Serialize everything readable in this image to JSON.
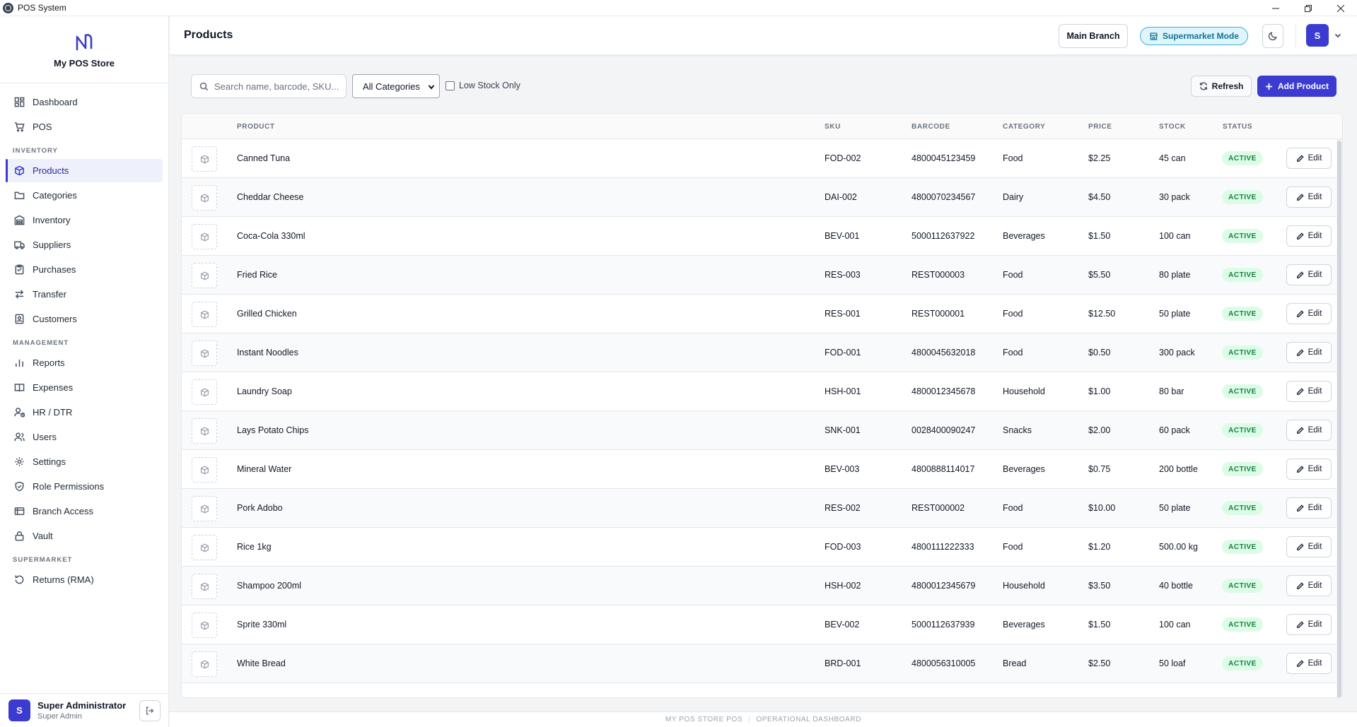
{
  "window": {
    "title": "POS System",
    "controls": [
      "minimize-icon",
      "restore-icon",
      "close-icon"
    ]
  },
  "sidebar": {
    "store_name": "My POS Store",
    "top_items": [
      {
        "label": "Dashboard",
        "icon": "dashboard-icon"
      },
      {
        "label": "POS",
        "icon": "cart-icon"
      }
    ],
    "sections": [
      {
        "label": "INVENTORY",
        "items": [
          {
            "label": "Products",
            "icon": "box-icon",
            "active": true
          },
          {
            "label": "Categories",
            "icon": "folder-icon"
          },
          {
            "label": "Inventory",
            "icon": "warehouse-icon"
          },
          {
            "label": "Suppliers",
            "icon": "truck-icon"
          },
          {
            "label": "Purchases",
            "icon": "clipboard-icon"
          },
          {
            "label": "Transfer",
            "icon": "transfer-icon"
          },
          {
            "label": "Customers",
            "icon": "contacts-icon"
          }
        ]
      },
      {
        "label": "MANAGEMENT",
        "items": [
          {
            "label": "Reports",
            "icon": "bar-chart-icon"
          },
          {
            "label": "Expenses",
            "icon": "book-icon"
          },
          {
            "label": "HR / DTR",
            "icon": "user-clock-icon"
          },
          {
            "label": "Users",
            "icon": "users-icon"
          },
          {
            "label": "Settings",
            "icon": "gear-icon"
          },
          {
            "label": "Role Permissions",
            "icon": "shield-icon"
          },
          {
            "label": "Branch Access",
            "icon": "building-icon"
          },
          {
            "label": "Vault",
            "icon": "lock-icon"
          }
        ]
      },
      {
        "label": "SUPERMARKET",
        "items": [
          {
            "label": "Returns (RMA)",
            "icon": "rotate-icon"
          }
        ]
      }
    ],
    "user": {
      "initial": "S",
      "name": "Super Administrator",
      "role": "Super Admin"
    }
  },
  "header": {
    "title": "Products",
    "branch": "Main Branch",
    "mode": "Supermarket Mode",
    "user_initial": "S"
  },
  "toolbar": {
    "search_placeholder": "Search name, barcode, SKU...",
    "category_selected": "All Categories",
    "low_stock_label": "Low Stock Only",
    "low_stock_checked": false,
    "refresh_label": "Refresh",
    "add_label": "Add Product"
  },
  "table": {
    "columns": {
      "product": "PRODUCT",
      "sku": "SKU",
      "barcode": "BARCODE",
      "category": "CATEGORY",
      "price": "PRICE",
      "stock": "STOCK",
      "status": "STATUS"
    },
    "edit_label": "Edit",
    "rows": [
      {
        "name": "Canned Tuna",
        "sku": "FOD-002",
        "barcode": "4800045123459",
        "category": "Food",
        "price": "$2.25",
        "stock": "45 can",
        "status": "ACTIVE"
      },
      {
        "name": "Cheddar Cheese",
        "sku": "DAI-002",
        "barcode": "4800070234567",
        "category": "Dairy",
        "price": "$4.50",
        "stock": "30 pack",
        "status": "ACTIVE"
      },
      {
        "name": "Coca-Cola 330ml",
        "sku": "BEV-001",
        "barcode": "5000112637922",
        "category": "Beverages",
        "price": "$1.50",
        "stock": "100 can",
        "status": "ACTIVE"
      },
      {
        "name": "Fried Rice",
        "sku": "RES-003",
        "barcode": "REST000003",
        "category": "Food",
        "price": "$5.50",
        "stock": "80 plate",
        "status": "ACTIVE"
      },
      {
        "name": "Grilled Chicken",
        "sku": "RES-001",
        "barcode": "REST000001",
        "category": "Food",
        "price": "$12.50",
        "stock": "50 plate",
        "status": "ACTIVE"
      },
      {
        "name": "Instant Noodles",
        "sku": "FOD-001",
        "barcode": "4800045632018",
        "category": "Food",
        "price": "$0.50",
        "stock": "300 pack",
        "status": "ACTIVE"
      },
      {
        "name": "Laundry Soap",
        "sku": "HSH-001",
        "barcode": "4800012345678",
        "category": "Household",
        "price": "$1.00",
        "stock": "80 bar",
        "status": "ACTIVE"
      },
      {
        "name": "Lays Potato Chips",
        "sku": "SNK-001",
        "barcode": "0028400090247",
        "category": "Snacks",
        "price": "$2.00",
        "stock": "60 pack",
        "status": "ACTIVE"
      },
      {
        "name": "Mineral Water",
        "sku": "BEV-003",
        "barcode": "4800888114017",
        "category": "Beverages",
        "price": "$0.75",
        "stock": "200 bottle",
        "status": "ACTIVE"
      },
      {
        "name": "Pork Adobo",
        "sku": "RES-002",
        "barcode": "REST000002",
        "category": "Food",
        "price": "$10.00",
        "stock": "50 plate",
        "status": "ACTIVE"
      },
      {
        "name": "Rice 1kg",
        "sku": "FOD-003",
        "barcode": "4800111222333",
        "category": "Food",
        "price": "$1.20",
        "stock": "500.00 kg",
        "status": "ACTIVE"
      },
      {
        "name": "Shampoo 200ml",
        "sku": "HSH-002",
        "barcode": "4800012345679",
        "category": "Household",
        "price": "$3.50",
        "stock": "40 bottle",
        "status": "ACTIVE"
      },
      {
        "name": "Sprite 330ml",
        "sku": "BEV-002",
        "barcode": "5000112637939",
        "category": "Beverages",
        "price": "$1.50",
        "stock": "100 can",
        "status": "ACTIVE"
      },
      {
        "name": "White Bread",
        "sku": "BRD-001",
        "barcode": "4800056310005",
        "category": "Bread",
        "price": "$2.50",
        "stock": "50 loaf",
        "status": "ACTIVE"
      }
    ]
  },
  "footer": {
    "left": "MY POS STORE POS",
    "right": "OPERATIONAL DASHBOARD"
  },
  "colors": {
    "accent": "#3b3bd1",
    "active_badge_bg": "#dcfce7",
    "active_badge_text": "#15803d",
    "mode_bg": "#e0f4fb",
    "mode_border": "#38b2d6"
  }
}
